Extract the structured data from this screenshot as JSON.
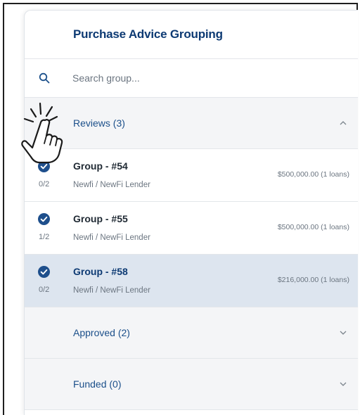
{
  "panel": {
    "title": "Purchase Advice Grouping"
  },
  "search": {
    "placeholder": "Search group..."
  },
  "sections": {
    "reviews": {
      "label": "Reviews (3)",
      "expanded": true,
      "chevron": "chevron-up-icon"
    },
    "approved": {
      "label": "Approved (2)",
      "expanded": false,
      "chevron": "chevron-down-icon"
    },
    "funded": {
      "label": "Funded (0)",
      "expanded": false,
      "chevron": "chevron-down-icon"
    }
  },
  "groups": [
    {
      "name": "Group - #54",
      "lender": "Newfi / NewFi Lender",
      "count": "0/2",
      "amount": "$500,000.00 (1 loans)",
      "checked": true,
      "selected": false
    },
    {
      "name": "Group - #55",
      "lender": "Newfi / NewFi Lender",
      "count": "1/2",
      "amount": "$500,000.00 (1 loans)",
      "checked": true,
      "selected": false
    },
    {
      "name": "Group - #58",
      "lender": "Newfi / NewFi Lender",
      "count": "0/2",
      "amount": "$216,000.00 (1 loans)",
      "checked": true,
      "selected": true
    }
  ],
  "colors": {
    "accent": "#0d3a73",
    "link": "#1b4f8a",
    "check": "#1e4f8c",
    "selected_row": "#dde5ef"
  }
}
